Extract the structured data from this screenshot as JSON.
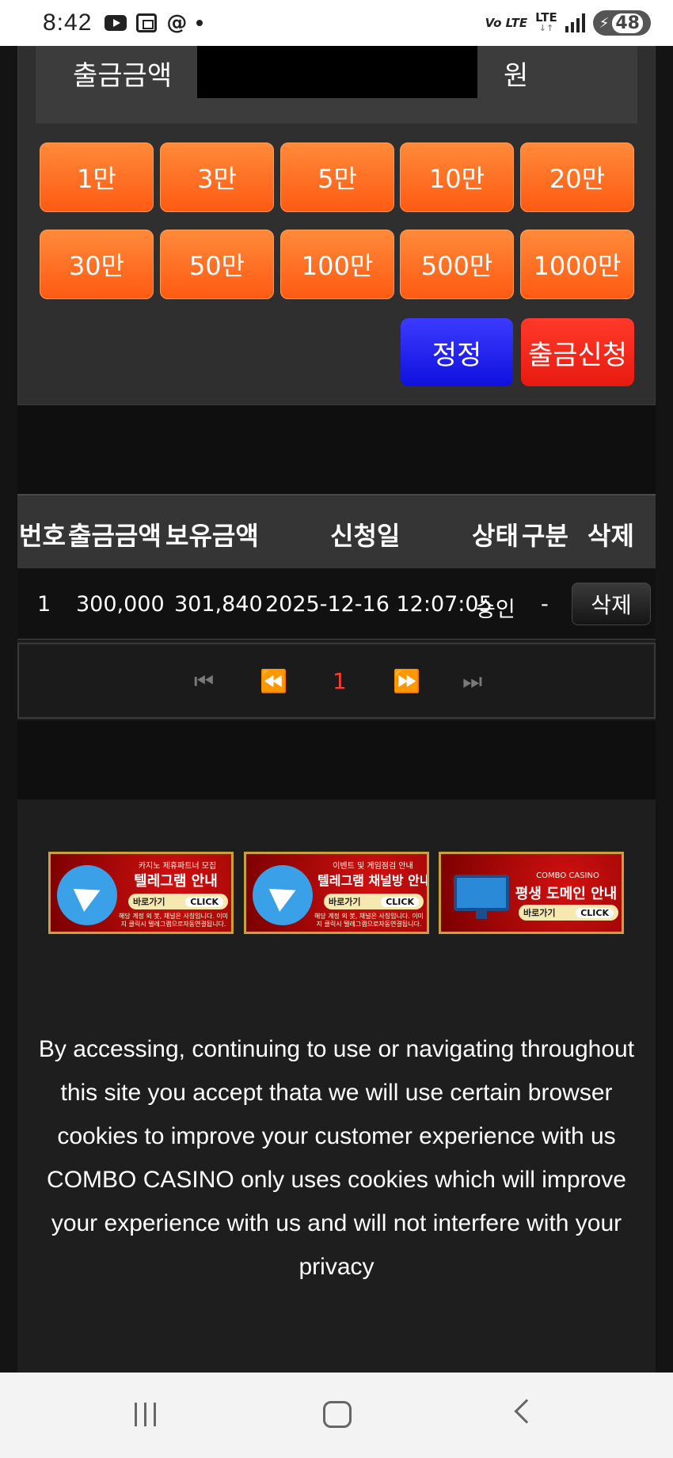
{
  "status_bar": {
    "time": "8:42",
    "network_volte": "Vo LTE",
    "network_lte": "LTE",
    "battery": "48",
    "icons": [
      "youtube-icon",
      "screenshot-icon",
      "threads-icon",
      "dot-icon",
      "signal-icon",
      "battery-icon"
    ]
  },
  "withdraw": {
    "amount_label": "출금금액",
    "amount_value": "",
    "amount_unit": "원",
    "chips": [
      "1만",
      "3만",
      "5만",
      "10만",
      "20만",
      "30만",
      "50만",
      "100만",
      "500만",
      "1000만"
    ],
    "reset_label": "정정",
    "apply_label": "출금신청"
  },
  "history": {
    "columns": [
      "번호",
      "출금금액",
      "보유금액",
      "신청일",
      "상태",
      "구분",
      "삭제"
    ],
    "rows": [
      {
        "no": "1",
        "amount": "300,000",
        "balance": "301,840",
        "date": "2025-12-16 12:07:05",
        "status": "승인",
        "type": "-",
        "delete_label": "삭제"
      }
    ],
    "pagination": {
      "first": "⏮",
      "prev": "⏪",
      "current": "1",
      "next": "⏩",
      "last": "⏭"
    }
  },
  "banners": [
    {
      "top_text": "카지노 제휴파트너 모집",
      "title": "텔레그램 안내",
      "go_label": "바로가기",
      "click_label": "CLICK",
      "bottom_text": "해당 계정 외 봇, 채널은 사칭입니다. 이미지 클릭시 텔레그램으로자동연결됩니다.",
      "icon": "telegram-icon"
    },
    {
      "top_text": "이벤트 및 게임점검 안내",
      "title": "텔레그램 채널방 안내",
      "go_label": "바로가기",
      "click_label": "CLICK",
      "bottom_text": "해당 계정 외 봇, 채널은 사칭입니다. 이미지 클릭시 텔레그램으로자동연결됩니다.",
      "icon": "telegram-icon"
    },
    {
      "top_text": "COMBO CASINO",
      "title": "평생 도메인 안내",
      "go_label": "바로가기",
      "click_label": "CLICK",
      "bottom_text": "",
      "icon": "monitor-icon"
    }
  ],
  "cookie_notice": "By accessing, continuing to use or navigating throughout this site you accept thata we will use certain browser cookies to improve your customer experience with us COMBO CASINO only uses cookies which will improve your experience with us and will not interfere with your privacy",
  "colors": {
    "chip_orange": "#ff6a1f",
    "reset_blue": "#2020f0",
    "apply_red": "#f02a1a",
    "page_current": "#ff3b2e"
  }
}
